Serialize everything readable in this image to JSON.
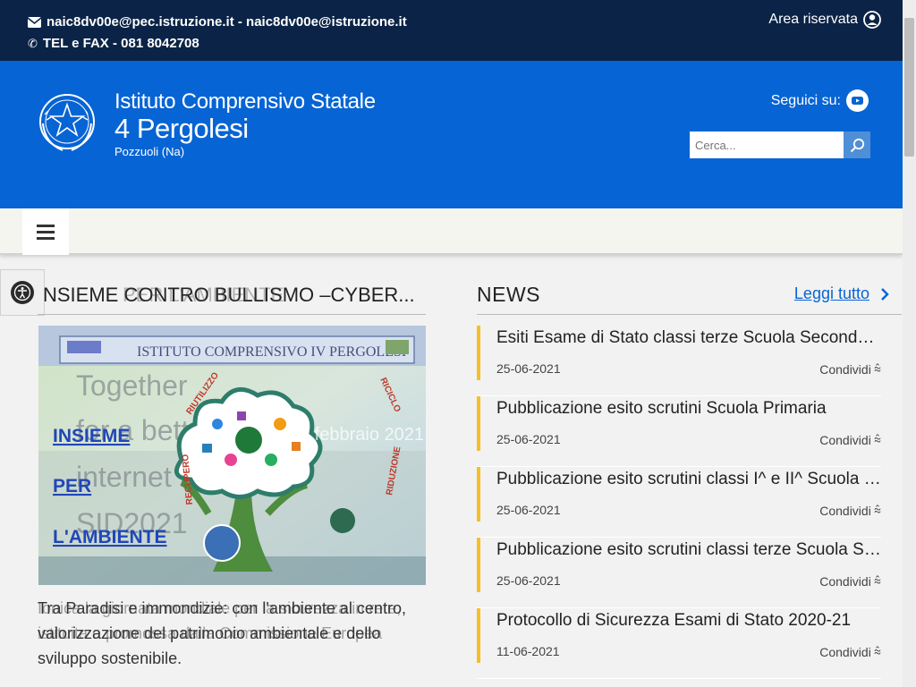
{
  "topbar": {
    "contact_email": "naic8dv00e@pec.istruzione.it - naic8dv00e@istruzione.it",
    "contact_phone": "TEL e FAX - 081 8042708",
    "reserved_area": "Area riservata"
  },
  "header": {
    "school_kind": "Istituto Comprensivo Statale",
    "school_name": "4 Pergolesi",
    "school_city": "Pozzuoli (Na)",
    "follow_label": "Seguici su:",
    "search_placeholder": "Cerca..."
  },
  "feature": {
    "title": "NSIEME CONTRO BULLISMO –CYBER...",
    "title_ghost": "PER L'AMBIENTE",
    "caption_ghost": "Ionica la giornata mondiale per la sicurezza in rete, istituita e promossa dalla Commissione Europea",
    "caption": "Tra Paradisi e immondizie: con l'ambiente al centro, valorizzazione del patrimonio ambientale e dello sviluppo sostenibile.",
    "image_text": {
      "banner": "ISTITUTO COMPRENSIVO IV PERGOLESI",
      "bg_line1": "Together",
      "bg_line2": "for a better",
      "bg_line3": "internet",
      "bg_line4": "SID2021",
      "word1": "INSIEME",
      "word2": "PER",
      "word3": "L'AMBIENTE",
      "ring_top_left": "RIUTILIZZO",
      "ring_top_right": "RICICLO",
      "ring_left": "RECUPERO",
      "ring_right": "RIDUZIONE",
      "date": "9 febbraio 2021"
    }
  },
  "news": {
    "title": "NEWS",
    "more_label": "Leggi tutto",
    "share_label": "Condividi",
    "items": [
      {
        "title": "Esiti Esame di Stato classi terze Scuola Secondaria di I grado",
        "date": "25-06-2021"
      },
      {
        "title": "Pubblicazione esito scrutini Scuola Primaria",
        "date": "25-06-2021"
      },
      {
        "title": "Pubblicazione esito scrutini classi I^ e II^ Scuola Secondaria di I grado",
        "date": "25-06-2021"
      },
      {
        "title": "Pubblicazione esito scrutini classi terze Scuola Secondaria di I grado",
        "date": "25-06-2021"
      },
      {
        "title": "Protocollo di Sicurezza Esami di Stato 2020-21",
        "date": "11-06-2021"
      }
    ]
  },
  "colors": {
    "topbar": "#0b2346",
    "header": "#0764d4",
    "accent_bar": "#f6bf26",
    "link": "#0764d4"
  }
}
